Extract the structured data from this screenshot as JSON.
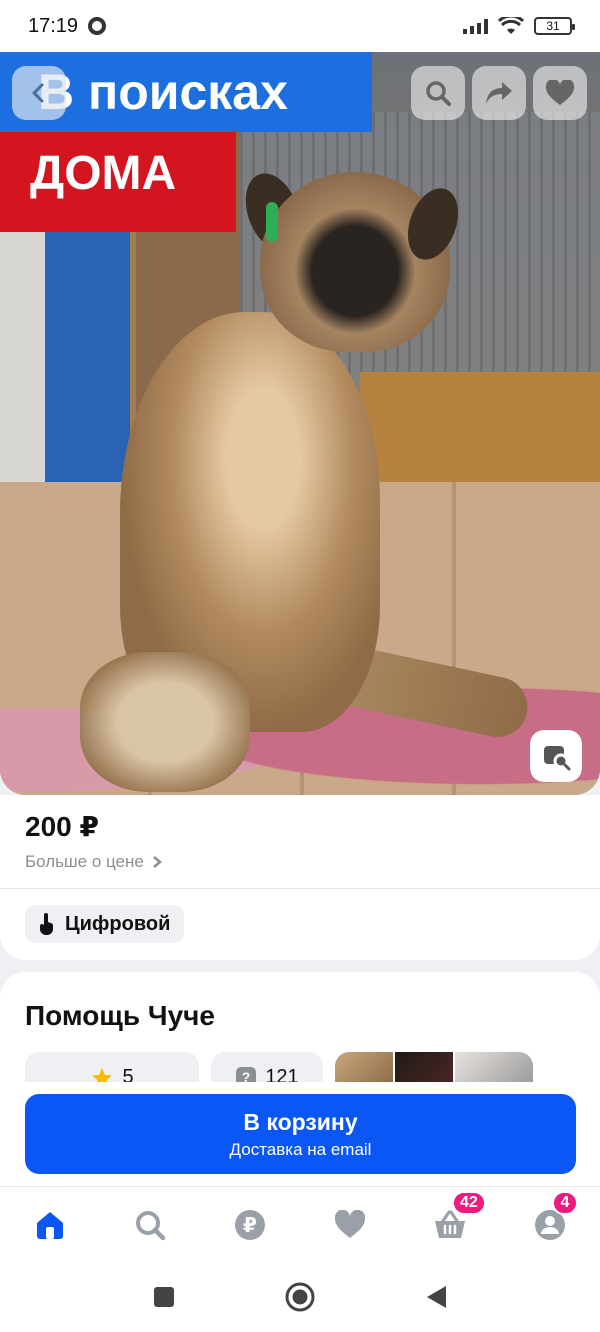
{
  "status_bar": {
    "time": "17:19",
    "battery": "31"
  },
  "photo": {
    "banner_line1": "В поисках",
    "banner_line2": "ДОМА"
  },
  "price": {
    "value": "200 ₽",
    "more_label": "Больше о цене"
  },
  "badge": {
    "label": "Цифровой"
  },
  "seller": {
    "title": "Помощь Чуче",
    "rating": "5",
    "questions": "121"
  },
  "cta": {
    "title": "В корзину",
    "subtitle": "Доставка на email"
  },
  "bottom_nav": {
    "cart_count": "42",
    "profile_count": "4"
  },
  "colors": {
    "accent": "#0a57f5",
    "badge": "#f0197d",
    "banner_blue": "#1d6fe0",
    "banner_red": "#d4141e"
  }
}
